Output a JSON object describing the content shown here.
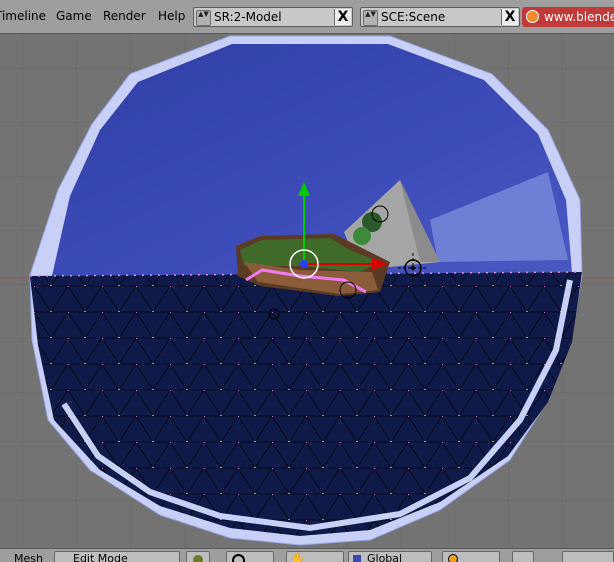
{
  "menu": {
    "timeline": "Timeline",
    "game": "Game",
    "render": "Render",
    "help": "Help"
  },
  "screen_selector": {
    "value": "SR:2-Model"
  },
  "scene_selector": {
    "value": "SCE:Scene"
  },
  "close_glyph": "X",
  "updown_glyph": "▲▼",
  "web_link": "www.blender",
  "bottom": {
    "mesh_label": "Mesh",
    "mode": "Edit Mode",
    "orientation": "Global"
  },
  "colors": {
    "dome_blue": "#3d4cb0",
    "mesh_dark": "#101a48",
    "dome_rim": "#c8d0f8",
    "vertex": "#e088e0",
    "header_bg": "#9e9e9e"
  }
}
